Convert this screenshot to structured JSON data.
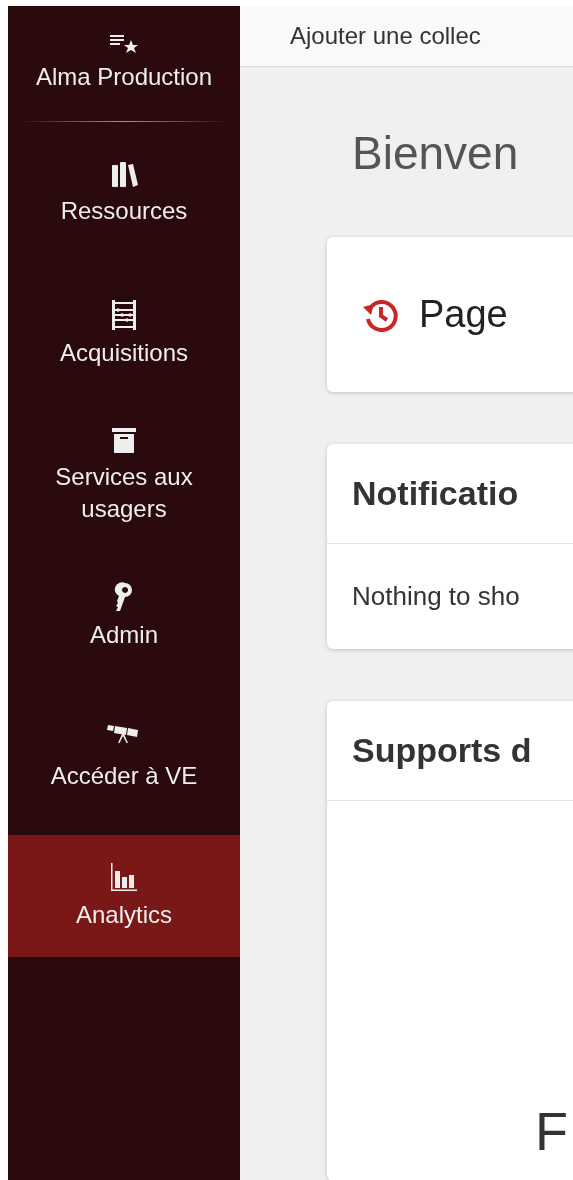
{
  "sidebar": {
    "brand": {
      "label": "Alma Production"
    },
    "items": [
      {
        "kind": "books",
        "label": "Ressources",
        "selected": false
      },
      {
        "kind": "abacus",
        "label": "Acquisitions",
        "selected": false
      },
      {
        "kind": "box",
        "label": "Services aux usagers",
        "selected": false
      },
      {
        "kind": "key",
        "label": "Admin",
        "selected": false
      },
      {
        "kind": "telescope",
        "label": "Accéder à VE",
        "selected": false
      },
      {
        "kind": "chart",
        "label": "Analytics",
        "selected": true
      }
    ]
  },
  "topbar": {
    "link": "Ajouter une collec"
  },
  "heading": "Bienven",
  "cards": [
    {
      "kind": "recent",
      "title": "Page"
    },
    {
      "kind": "list",
      "title": "Notificatio",
      "body": "Nothing to sho"
    },
    {
      "kind": "widget",
      "title": "Supports d",
      "big_text": "F"
    }
  ]
}
